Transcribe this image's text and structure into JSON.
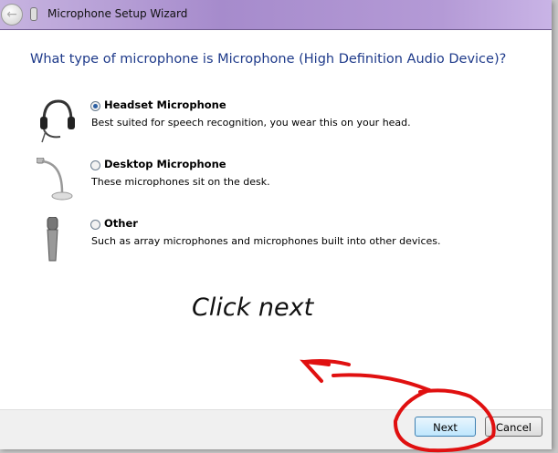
{
  "window": {
    "title": "Microphone Setup Wizard"
  },
  "question": "What type of microphone is Microphone (High Definition Audio Device)?",
  "options": [
    {
      "label": "Headset Microphone",
      "description": "Best suited for speech recognition, you wear this on your head.",
      "selected": true,
      "icon": "headset-icon"
    },
    {
      "label": "Desktop Microphone",
      "description": "These microphones sit on the desk.",
      "selected": false,
      "icon": "desktop-microphone-icon"
    },
    {
      "label": "Other",
      "description": "Such as array microphones and microphones built into other devices.",
      "selected": false,
      "icon": "handheld-microphone-icon"
    }
  ],
  "annotation": {
    "text": "Click next",
    "color": "#e01010"
  },
  "buttons": {
    "next": "Next",
    "cancel": "Cancel"
  }
}
